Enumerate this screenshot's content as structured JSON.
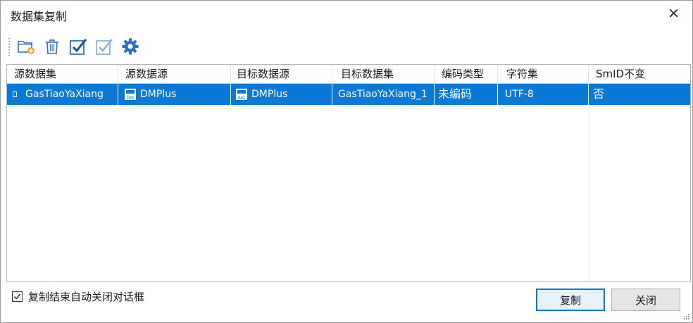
{
  "window": {
    "title": "数据集复制",
    "close_glyph": "✕"
  },
  "toolbar": [
    {
      "name": "add-dataset-button",
      "icon": "folder-add-icon"
    },
    {
      "name": "delete-button",
      "icon": "trash-icon"
    },
    {
      "name": "select-all-button",
      "icon": "checkbox-checked-icon"
    },
    {
      "name": "invert-select-button",
      "icon": "checkbox-light-icon"
    },
    {
      "name": "settings-button",
      "icon": "gear-icon"
    }
  ],
  "table": {
    "columns": [
      "源数据集",
      "源数据源",
      "目标数据源",
      "目标数据集",
      "编码类型",
      "字符集",
      "SmID不变"
    ],
    "rows": [
      {
        "source_dataset": "GasTiaoYaXiang",
        "source_datasource": "DMPlus",
        "target_datasource": "DMPlus",
        "target_dataset": "GasTiaoYaXiang_1",
        "encoding": "未编码",
        "charset": "UTF-8",
        "smid_keep": "否"
      }
    ]
  },
  "footer": {
    "auto_close_label": "复制结束自动关闭对话框",
    "auto_close_checked": true,
    "copy_button": "复制",
    "close_button": "关闭"
  },
  "colors": {
    "selection": "#0a78d7",
    "accent_icon": "#2f6fb5"
  }
}
